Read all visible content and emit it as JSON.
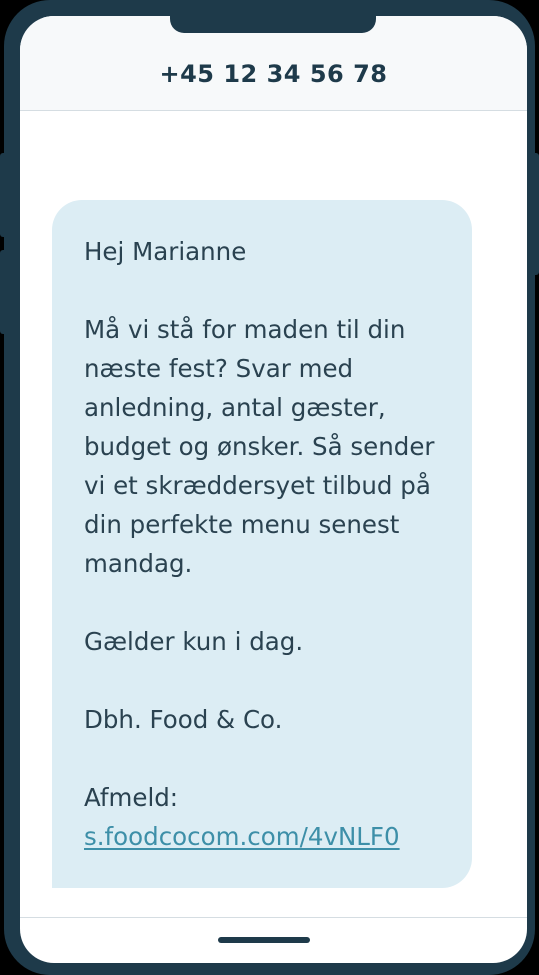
{
  "header": {
    "phone_number": "+45 12 34 56 78"
  },
  "message": {
    "greeting": "Hej Marianne",
    "body": "Må vi stå for maden til din næste fest? Svar med anledning, antal gæster, budget og ønsker. Så sender vi et skræddersyet tilbud på din perfekte menu senest mandag.",
    "notice": "Gælder kun i dag.",
    "signature": "Dbh. Food & Co.",
    "unsubscribe_label": "Afmeld:",
    "unsubscribe_link": "s.foodcocom.com/4vNLF0"
  },
  "colors": {
    "frame": "#1e3a4a",
    "bubble": "#dcedf4",
    "text": "#2a4250",
    "link": "#3d8fa8"
  }
}
